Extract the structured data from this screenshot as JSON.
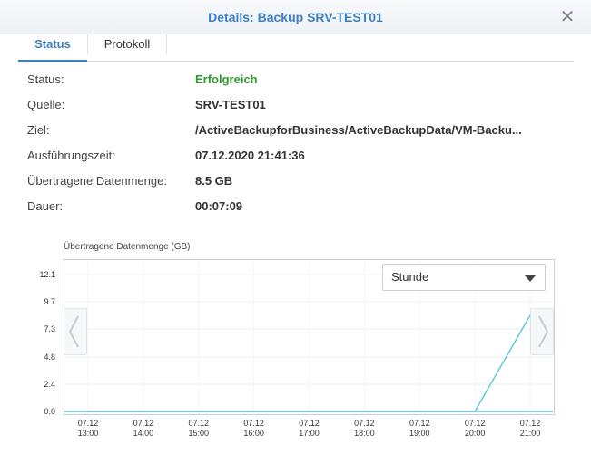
{
  "window": {
    "title": "Details: Backup SRV-TEST01",
    "close_icon": "close-icon"
  },
  "tabs": [
    {
      "label": "Status",
      "active": true
    },
    {
      "label": "Protokoll",
      "active": false
    }
  ],
  "details": [
    {
      "label": "Status:",
      "value": "Erfolgreich"
    },
    {
      "label": "Quelle:",
      "value": "SRV-TEST01"
    },
    {
      "label": "Ziel:",
      "value": "/ActiveBackupforBusiness/ActiveBackupData/VM-Backu..."
    },
    {
      "label": "Ausführungszeit:",
      "value": "07.12.2020 21:41:36"
    },
    {
      "label": "Übertragene Datenmenge:",
      "value": "8.5 GB"
    },
    {
      "label": "Dauer:",
      "value": "00:07:09"
    }
  ],
  "colors": {
    "accent": "#3d7fc1",
    "success": "#2e9a2e",
    "line": "#67c6dc"
  },
  "dropdown": {
    "selected": "Stunde"
  },
  "chart_data": {
    "type": "line",
    "title": "Übertragene Datenmenge (GB)",
    "ylim": [
      0,
      12.1
    ],
    "yticks": [
      "12.1",
      "9.7",
      "7.3",
      "4.8",
      "2.4",
      "0.0"
    ],
    "categories": [
      [
        "07.12",
        "13:00"
      ],
      [
        "07.12",
        "14:00"
      ],
      [
        "07.12",
        "15:00"
      ],
      [
        "07.12",
        "16:00"
      ],
      [
        "07.12",
        "17:00"
      ],
      [
        "07.12",
        "18:00"
      ],
      [
        "07.12",
        "19:00"
      ],
      [
        "07.12",
        "20:00"
      ],
      [
        "07.12",
        "21:00"
      ]
    ],
    "values": [
      0,
      0,
      0,
      0,
      0,
      0,
      0,
      0,
      8.5
    ],
    "grid": true
  }
}
